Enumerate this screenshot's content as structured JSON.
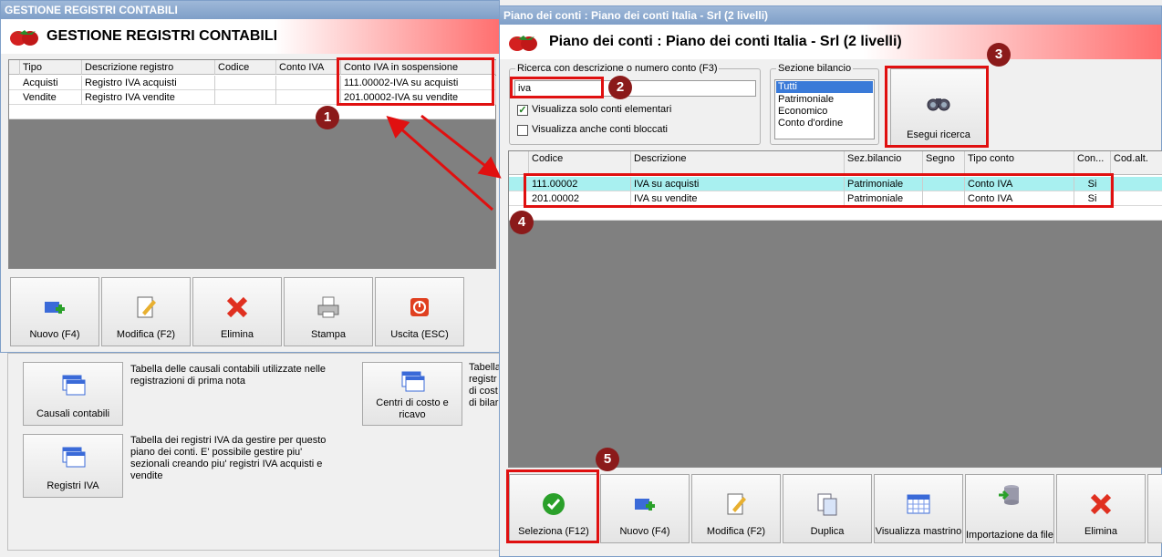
{
  "left_window": {
    "titlebar": "GESTIONE REGISTRI CONTABILI",
    "header": "GESTIONE REGISTRI CONTABILI",
    "columns": [
      "Tipo",
      "Descrizione registro",
      "Codice",
      "Conto IVA",
      "Conto IVA in sospensione"
    ],
    "rows": [
      [
        "Acquisti",
        "Registro IVA acquisti",
        "",
        "",
        "111.00002-IVA su acquisti"
      ],
      [
        "Vendite",
        "Registro IVA vendite",
        "",
        "",
        "201.00002-IVA su vendite"
      ]
    ],
    "toolbar": [
      "Nuovo (F4)",
      "Modifica (F2)",
      "Elimina",
      "Stampa",
      "Uscita (ESC)"
    ]
  },
  "background": {
    "causali_button": "Causali contabili",
    "causali_desc": "Tabella delle causali contabili utilizzate nelle registrazioni di prima nota",
    "registri_button": "Registri IVA",
    "registri_desc": "Tabella dei registri IVA da gestire per questo piano dei conti. E' possibile gestire piu' sezionali creando piu' registri IVA acquisti e vendite",
    "centri_button": "Centri di costo e ricavo",
    "centri_desc_partial": "Tabella\nregistr\ndi cost\ndi bilar"
  },
  "right_window": {
    "titlebar": "Piano dei conti : Piano dei conti Italia - Srl (2 livelli)",
    "header": "Piano dei conti : Piano dei conti Italia - Srl (2 livelli)",
    "search_group_label": "Ricerca con descrizione o numero conto (F3)",
    "search_value": "iva",
    "chk_elementari": "Visualizza solo conti elementari",
    "chk_elementari_checked": true,
    "chk_bloccati": "Visualizza anche conti bloccati",
    "chk_bloccati_checked": false,
    "sezione_label": "Sezione bilancio",
    "sezione_options": [
      "Tutti",
      "Patrimoniale",
      "Economico",
      "Conto d'ordine"
    ],
    "sezione_selected": "Tutti",
    "search_button": "Esegui ricerca",
    "columns": [
      "Codice",
      "Descrizione",
      "Sez.bilancio",
      "Segno",
      "Tipo conto",
      "Con...",
      "Cod.alt."
    ],
    "rows": [
      [
        "111.00002",
        "IVA su acquisti",
        "Patrimoniale",
        "",
        "Conto IVA",
        "Si",
        ""
      ],
      [
        "201.00002",
        "IVA su vendite",
        "Patrimoniale",
        "",
        "Conto IVA",
        "Si",
        ""
      ]
    ],
    "toolbar": [
      "Seleziona (F12)",
      "Nuovo (F4)",
      "Modifica (F2)",
      "Duplica",
      "Visualizza mastrino",
      "Importazione da file",
      "Elimina"
    ]
  },
  "badges": [
    "1",
    "2",
    "3",
    "4",
    "5"
  ],
  "colors": {
    "highlight": "#e01010",
    "badge": "#8b1a1a",
    "selected_row": "#a8f0f0",
    "header_gradient_end": "#ff6f6f"
  }
}
